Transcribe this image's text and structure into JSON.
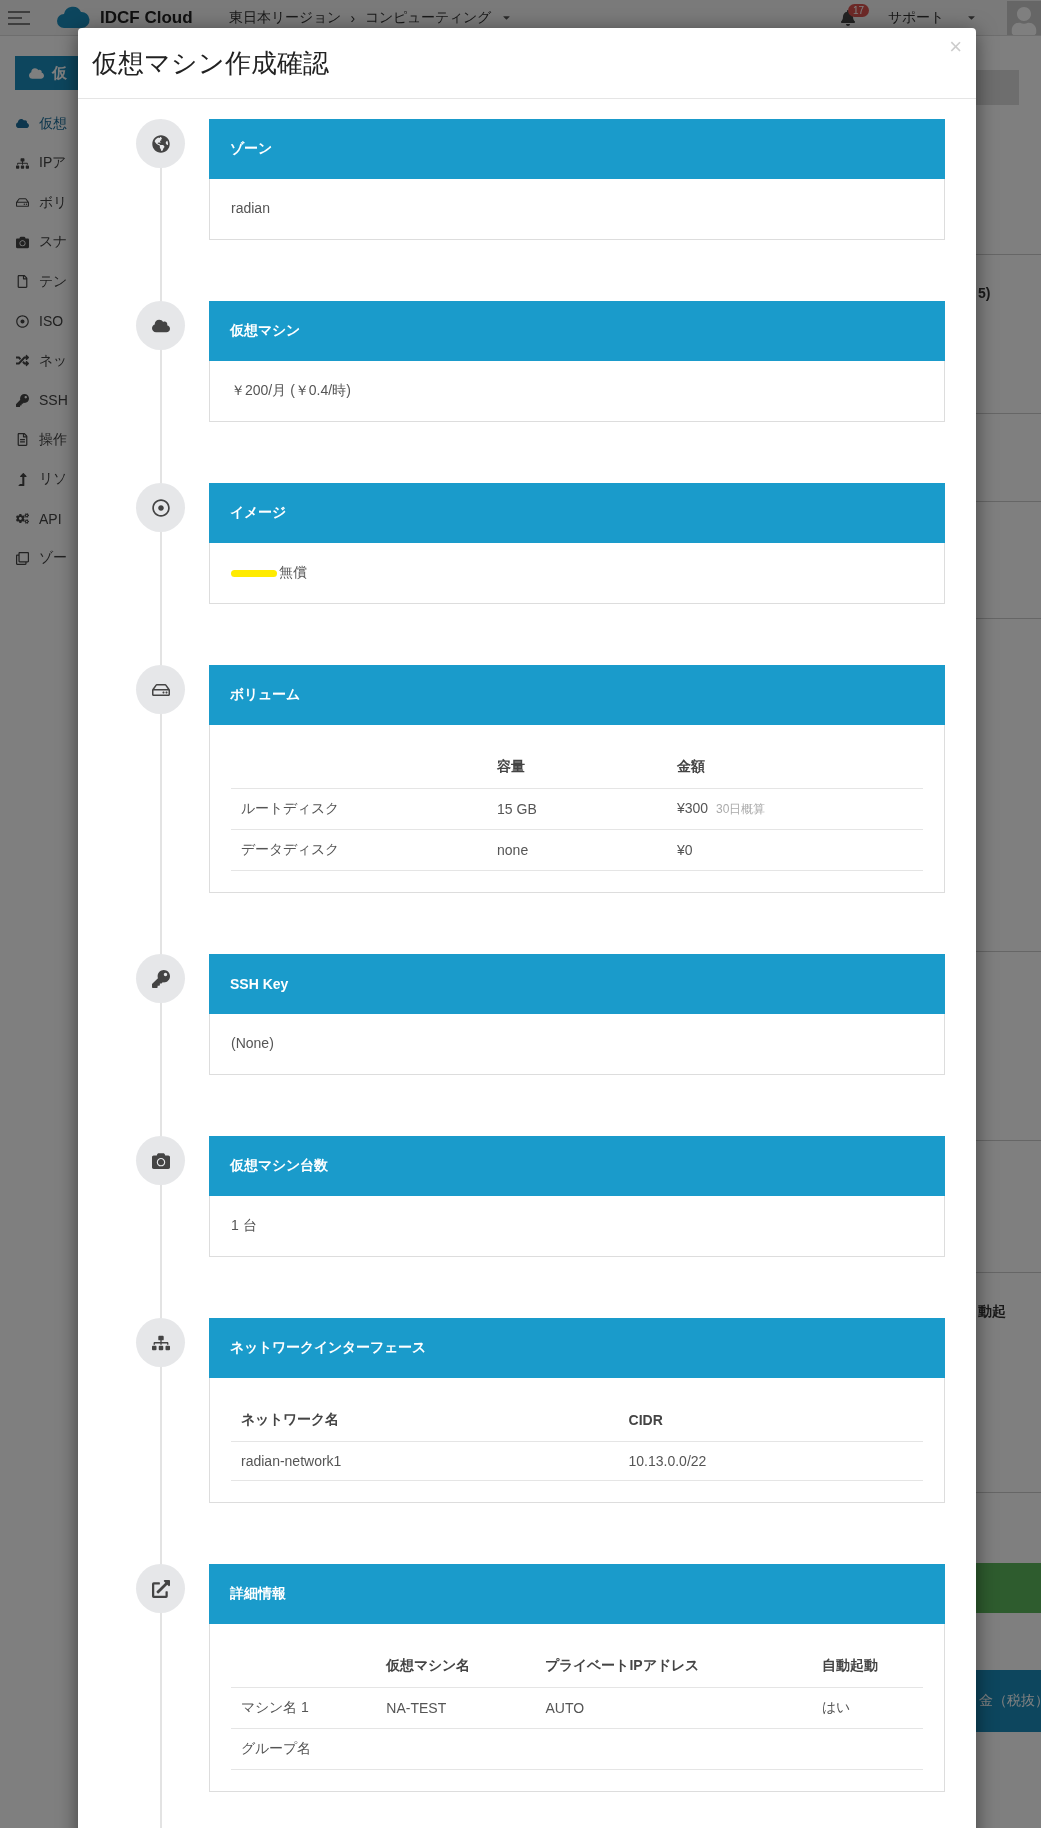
{
  "topbar": {
    "brand": "IDCF Cloud",
    "breadcrumb": [
      "東日本リージョン",
      "›",
      "コンピューティング"
    ],
    "notifications": "17",
    "support": "サポート"
  },
  "sidebar": {
    "button": "仮",
    "items": [
      {
        "label": "仮想",
        "selected": true
      },
      {
        "label": "IPア",
        "selected": false
      },
      {
        "label": "ボリ",
        "selected": false
      },
      {
        "label": "スナ",
        "selected": false
      },
      {
        "label": "テン",
        "selected": false
      },
      {
        "label": "ISO",
        "selected": false
      },
      {
        "label": "ネッ",
        "selected": false
      },
      {
        "label": "SSH",
        "selected": false
      },
      {
        "label": "操作",
        "selected": false
      },
      {
        "label": "リソ",
        "selected": false
      },
      {
        "label": "API",
        "selected": false
      },
      {
        "label": "ゾー",
        "selected": false
      }
    ]
  },
  "background_fragments": [
    "5)",
    "動起",
    "金（税抜）"
  ],
  "modal": {
    "title": "仮想マシン作成確認",
    "close": "×",
    "sections": [
      {
        "title": "ゾーン",
        "kind": "text",
        "text": "radian"
      },
      {
        "title": "仮想マシン",
        "kind": "text",
        "text": "￥200/月 (￥0.4/時)"
      },
      {
        "title": "イメージ",
        "kind": "text",
        "text": "無償",
        "redacted": true
      },
      {
        "title": "ボリューム",
        "kind": "table",
        "columns": [
          "容量",
          "金額"
        ],
        "rows": [
          {
            "label": "ルートディスク",
            "cells": [
              {
                "text": "15 GB"
              },
              {
                "text": "¥300",
                "note": "30日概算"
              }
            ]
          },
          {
            "label": "データディスク",
            "cells": [
              {
                "text": "none"
              },
              {
                "text": "¥0"
              }
            ]
          }
        ]
      },
      {
        "title": "SSH Key",
        "kind": "text",
        "text": "(None)"
      },
      {
        "title": "仮想マシン台数",
        "kind": "text",
        "text": "1 台"
      },
      {
        "title": "ネットワークインターフェース",
        "kind": "table",
        "columns": [
          "ネットワーク名",
          "CIDR"
        ],
        "rows": [
          {
            "cells": [
              {
                "text": "radian-network1"
              },
              {
                "text": "10.13.0.0/22"
              }
            ]
          }
        ]
      },
      {
        "title": "詳細情報",
        "kind": "table",
        "columns": [
          "仮想マシン名",
          "プライベートIPアドレス",
          "自動起動"
        ],
        "rows": [
          {
            "label": "マシン名 1",
            "cells": [
              {
                "text": "NA-TEST"
              },
              {
                "text": "AUTO"
              },
              {
                "text": "はい"
              }
            ]
          },
          {
            "label": "グループ名"
          }
        ]
      }
    ]
  }
}
